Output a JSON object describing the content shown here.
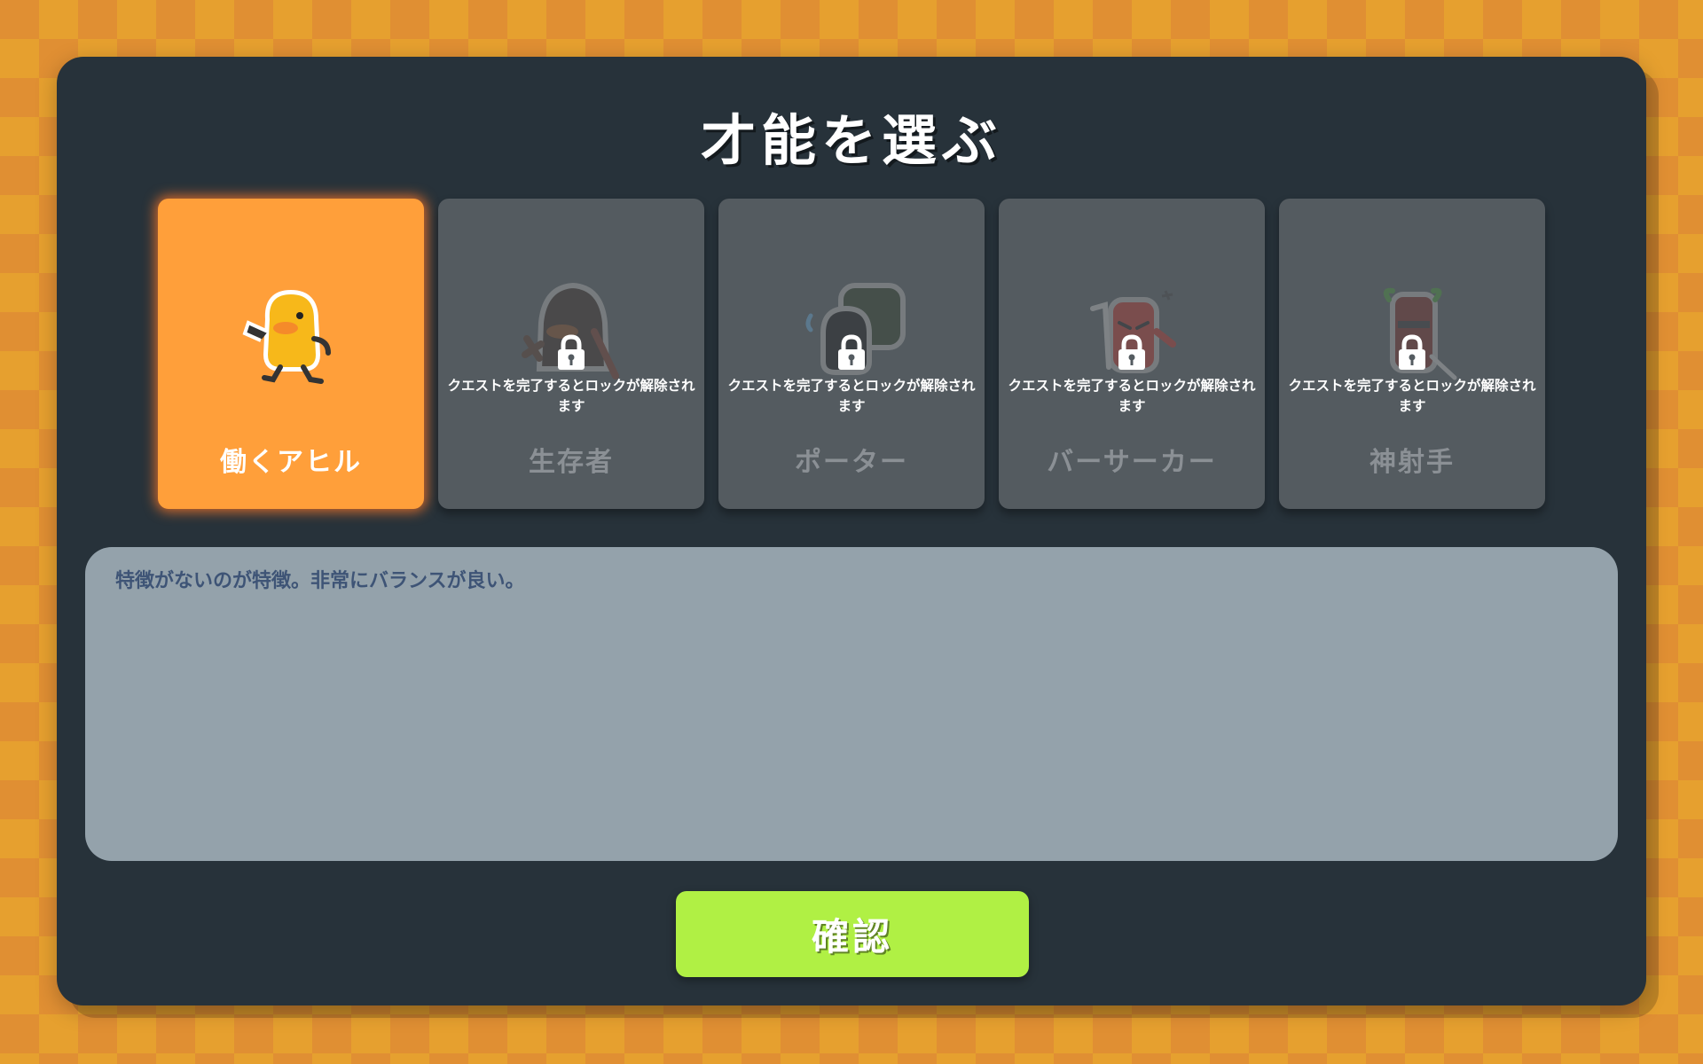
{
  "title": "才能を選ぶ",
  "cards": [
    {
      "name": "働くアヒル",
      "icon": "duck-icon",
      "selected": true,
      "locked": false
    },
    {
      "name": "生存者",
      "icon": "survivor-icon",
      "selected": false,
      "locked": true
    },
    {
      "name": "ポーター",
      "icon": "porter-icon",
      "selected": false,
      "locked": true
    },
    {
      "name": "バーサーカー",
      "icon": "berserker-icon",
      "selected": false,
      "locked": true
    },
    {
      "name": "神射手",
      "icon": "marksman-icon",
      "selected": false,
      "locked": true
    }
  ],
  "lock_text": "クエストを完了するとロックが解除されます",
  "description": "特徴がないのが特徴。非常にバランスが良い。",
  "confirm_label": "確認",
  "colors": {
    "selected_card": "#ff9f3a",
    "locked_card": "#545b60",
    "confirm_button": "#b0f044",
    "panel": "#27323a",
    "description_box": "#94a2ab"
  }
}
